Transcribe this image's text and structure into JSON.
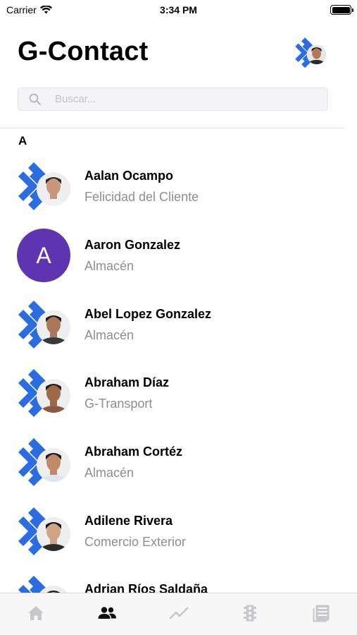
{
  "status_bar": {
    "carrier": "Carrier",
    "time": "3:34 PM"
  },
  "header": {
    "title": "G-Contact",
    "avatar_icon": "company-logo-with-user-photo"
  },
  "search": {
    "placeholder": "Buscar...",
    "value": ""
  },
  "sections": [
    {
      "letter": "A"
    }
  ],
  "contacts": [
    {
      "name": "Aalan Ocampo",
      "department": "Felicidad del Cliente",
      "avatar": "logo-photo",
      "skin": "#c99878",
      "shirt": "#f2f2f2",
      "hair": "#2a2a2a"
    },
    {
      "name": "Aaron Gonzalez",
      "department": "Almacén",
      "avatar": "initial",
      "initial": "A"
    },
    {
      "name": "Abel Lopez Gonzalez",
      "department": "Almacén",
      "avatar": "logo-photo",
      "skin": "#a8785a",
      "shirt": "#3a3a3a",
      "hair": "#1c1c1c"
    },
    {
      "name": "Abraham Díaz",
      "department": "G-Transport",
      "avatar": "logo-photo",
      "skin": "#9a6a4a",
      "shirt": "#8a5840",
      "hair": "#1e1e1e"
    },
    {
      "name": "Abraham Cortéz",
      "department": "Almacén",
      "avatar": "logo-photo",
      "skin": "#c08a6a",
      "shirt": "#dfe6f2",
      "hair": "#1a1a1a"
    },
    {
      "name": "Adilene Rivera",
      "department": "Comercio Exterior",
      "avatar": "logo-photo",
      "skin": "#d2a486",
      "shirt": "#2b2b2b",
      "hair": "#141414"
    },
    {
      "name": "Adrian Ríos Saldaña",
      "department": "",
      "avatar": "logo-photo",
      "skin": "#b88a68",
      "shirt": "#444444",
      "hair": "#1a1a1a"
    }
  ],
  "tab_bar": {
    "tabs": [
      {
        "icon": "home-icon",
        "active": false
      },
      {
        "icon": "contacts-icon",
        "active": true
      },
      {
        "icon": "trending-icon",
        "active": false
      },
      {
        "icon": "traffic-light-icon",
        "active": false
      },
      {
        "icon": "news-icon",
        "active": false
      }
    ]
  },
  "colors": {
    "logo_blue": "#2b6de0",
    "logo_blue_light": "#3d8bf2",
    "initial_avatar_bg": "#5e35b1",
    "secondary_text": "#8e8e93",
    "tab_active": "#111111",
    "tab_inactive": "#c7c7cc"
  }
}
